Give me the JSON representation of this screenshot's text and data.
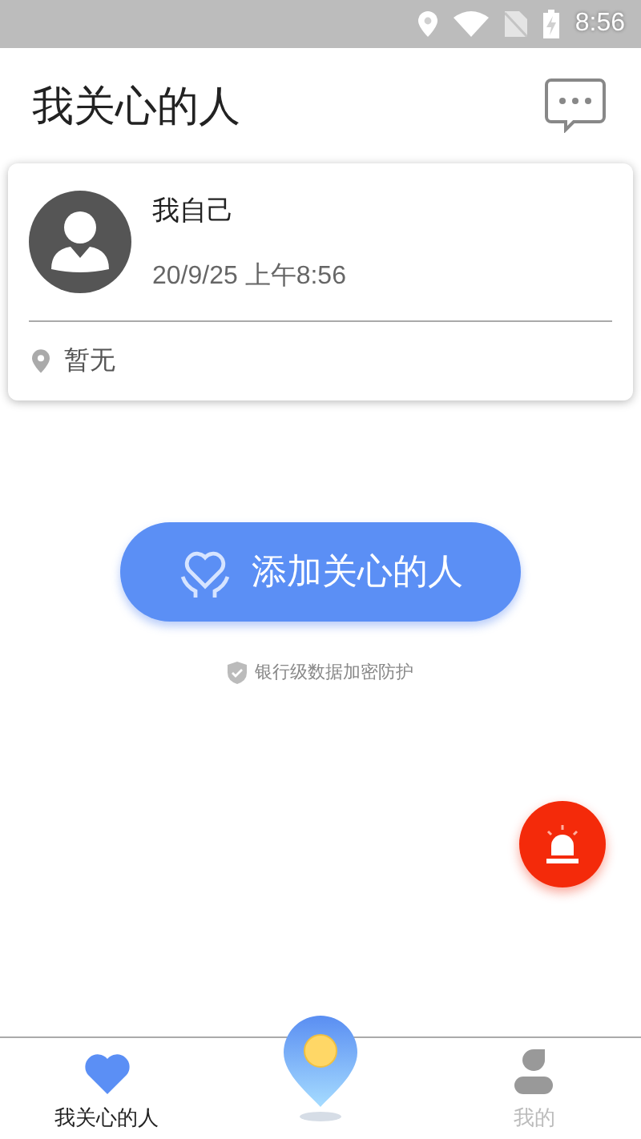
{
  "status_bar": {
    "time": "8:56"
  },
  "header": {
    "title": "我关心的人"
  },
  "people": [
    {
      "name": "我自己",
      "time": "20/9/25 上午8:56",
      "location": "暂无"
    }
  ],
  "add_button": {
    "label": "添加关心的人"
  },
  "security_note": "银行级数据加密防护",
  "bottom_nav": [
    {
      "kind": "heart",
      "label": "我关心的人",
      "selected": true
    },
    {
      "kind": "pin",
      "selected": false
    },
    {
      "kind": "person",
      "label": "我的",
      "selected": false
    }
  ]
}
